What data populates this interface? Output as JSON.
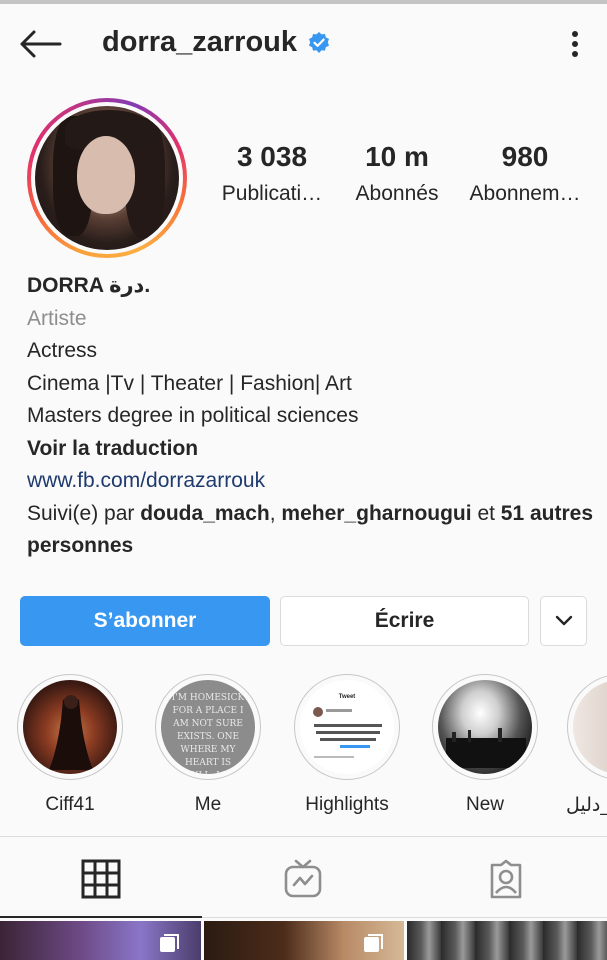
{
  "header": {
    "username": "dorra_zarrouk",
    "verified": true,
    "icons": {
      "back": "arrow-left-icon",
      "verified": "verified-badge-icon",
      "more": "more-vertical-icon"
    }
  },
  "stats": {
    "posts": {
      "value": "3 038",
      "label": "Publicati…"
    },
    "followers": {
      "value": "10 m",
      "label": "Abonnés"
    },
    "following": {
      "value": "980",
      "label": "Abonnem…"
    }
  },
  "bio": {
    "name": "DORRA درة.",
    "category": "Artiste",
    "lines": [
      "Actress",
      "Cinema |Tv | Theater | Fashion| Art",
      "Masters degree in political sciences"
    ],
    "translate": "Voir la traduction",
    "link": "www.fb.com/dorrazarrouk",
    "followed_by": {
      "prefix": "Suivi(e) par ",
      "user1": "douda_mach",
      "sep": ", ",
      "user2": "meher_gharnougui",
      "conj": " et ",
      "others": "51 autres personnes"
    }
  },
  "actions": {
    "follow": "S’abonner",
    "message": "Écrire",
    "suggest_icon": "chevron-down-icon"
  },
  "highlights": [
    {
      "label": "Ciff41"
    },
    {
      "label": "Me",
      "text": "I'M HOMESICK FOR A PLACE I AM NOT SURE EXISTS. ONE WHERE MY HEART IS FULL, MY BODY LOVED AND MY SOUL UNDERSTOOD"
    },
    {
      "label": "Highlights",
      "tweet_header": "Tweet"
    },
    {
      "label": "New"
    },
    {
      "label": "دليل_"
    }
  ],
  "tabs": [
    {
      "name": "grid",
      "icon": "grid-icon",
      "active": true
    },
    {
      "name": "igtv",
      "icon": "igtv-icon",
      "active": false
    },
    {
      "name": "tagged",
      "icon": "tagged-person-icon",
      "active": false
    }
  ],
  "colors": {
    "accent": "#3897f0",
    "text": "#262626",
    "secondary": "#8e8e8e",
    "link": "#1e3a6e",
    "background": "#fafafa"
  }
}
